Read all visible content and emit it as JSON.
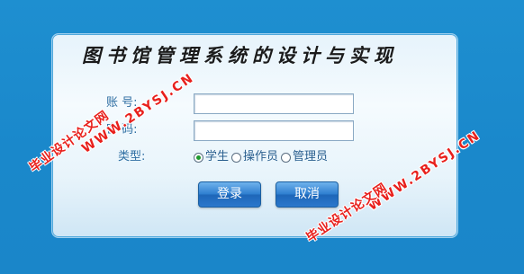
{
  "login": {
    "title": "图书馆管理系统的设计与实现",
    "account_label": "账    号:",
    "password_label": "密    码:",
    "type_label": "类型:",
    "account_value": "",
    "password_value": "",
    "roles": [
      {
        "label": "学生",
        "checked": true
      },
      {
        "label": "操作员",
        "checked": false
      },
      {
        "label": "管理员",
        "checked": false
      }
    ],
    "login_button": "登录",
    "cancel_button": "取消"
  },
  "watermarks": {
    "cn_text": "毕业设计论文网",
    "url_text": "WWW.2BYSJ.CN"
  },
  "colors": {
    "background": "#1a88cb",
    "label_text": "#2f6fa3",
    "button": "#2f7fd0",
    "watermark": "#e8201c",
    "radio_checked": "#1e9a2e"
  }
}
